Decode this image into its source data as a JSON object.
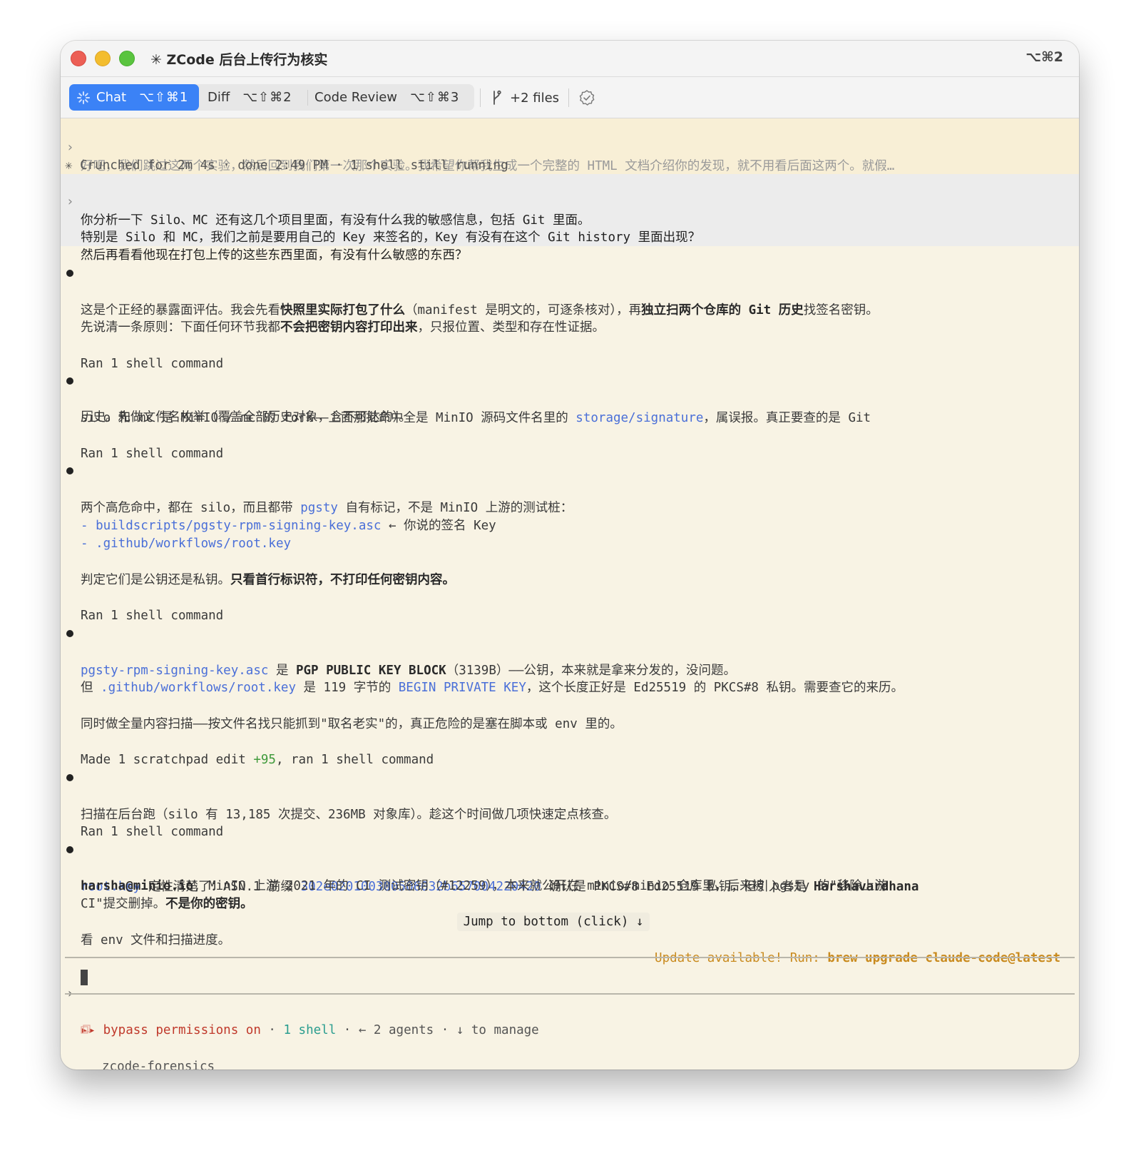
{
  "window": {
    "title": "✳ ZCode 后台上传行为核实",
    "shortcut": "⌥⌘2"
  },
  "tabs": [
    {
      "label": "Chat",
      "shortcut": "⌥⇧⌘1",
      "active": true
    },
    {
      "label": "Diff",
      "shortcut": "⌥⇧⌘2",
      "active": false
    },
    {
      "label": "Code Review",
      "shortcut": "⌥⇧⌘3",
      "active": false
    }
  ],
  "files_label": "+2 files",
  "colors": {
    "accent": "#3b82f6",
    "background": "#f8f3e4",
    "link": "#4a6fd8",
    "warning": "#c98a1d",
    "danger": "#c0392b"
  },
  "transcript": {
    "prev_prompt": "好吧，我们跳过这两个实验，然后回到我们第一次那个实验。我希望你帮我生成一个完整的 HTML 文档介绍你的发现，就不用看后面这两个。就假…",
    "crunched": "✳ Crunched for 2m 4s · done 2:49 PM · 1 shell still running",
    "user_prompt": [
      "你分析一下 Silo、MC 还有这几个项目里面，有没有什么我的敏感信息，包括 Git 里面。",
      "特别是 Silo 和 MC，我们之前是要用自己的 Key 来签名的，Key 有没有在这个 Git history 里面出现？",
      "然后再看看他现在打包上传的这些东西里面，有没有什么敏感的东西？"
    ],
    "m1": {
      "a": "这是个正经的暴露面评估。我会先看",
      "b": "快照里实际打包了什么",
      "c": "（manifest 是明文的，可逐条核对），再",
      "d": "独立扫两个仓库的 Git 历史",
      "e": "找签名密钥。",
      "p2a": "先说清一条原则：下面任何环节我都",
      "p2b": "不会把密钥内容打印出来",
      "p2c": "，只报位置、类型和存在性证据。",
      "ran": "Ran 1 shell command"
    },
    "m2": {
      "a": "silo 和 mc 是 MinIO / mc 的 fork——上面那批命中全是 MinIO 源码文件名里的 ",
      "link": "storage/signature",
      "b": "，属误报。真正要查的是 Git",
      "c": "历史。先做文件名枚举（覆盖全部历史对象，含不可达的）。",
      "ran": "Ran 1 shell command"
    },
    "m3": {
      "a": "两个高危命中，都在 silo，而且都带 ",
      "link": "pgsty",
      "b": " 自有标记，不是 MinIO 上游的测试桩：",
      "item1_dash": "- ",
      "item1_link": "buildscripts/pgsty-rpm-signing-key.asc",
      "item1_note": " ← 你说的签名 Key",
      "item2_dash": "- ",
      "item2_link": ".github/workflows/root.key",
      "p2a": "判定它们是公钥还是私钥。",
      "p2b": "只看首行标识符，不打印任何密钥内容。",
      "ran": "Ran 1 shell command"
    },
    "m4": {
      "link": "pgsty-rpm-signing-key.asc",
      "a": " 是 ",
      "b": "PGP PUBLIC KEY BLOCK",
      "c": "（3139B）——公钥，本来就是拿来分发的，没问题。",
      "p2a": "但 ",
      "p2link": ".github/workflows/root.key",
      "p2b": " 是 119 字节的 ",
      "p2link2": "BEGIN PRIVATE KEY",
      "p2c": "，这个长度正好是 Ed25519 的 PKCS#8 私钥。需要查它的来历。",
      "p3": "同时做全量内容扫描——按文件名找只能抓到\"取名老实\"的，真正危险的是塞在脚本或 env 里的。",
      "made_a": "Made 1 scratchpad edit ",
      "made_plus": "+95",
      "made_b": ", ran 1 shell command"
    },
    "m5": {
      "a": "扫描在后台跑（silo 有 13,185 次提交、236MB 对象库）。趁这个时间做几项快速定点核查。",
      "ran": "Ran 1 shell command"
    },
    "m6": {
      "link": "root.key",
      "a": " 定性清楚了：ASN.1 前缀 ",
      "hex": "302e020100300506032b657004220420",
      "b": " 确认是 PKCS#8 Ed25519 私钥，但引入者是 ",
      "name": "Harshavardhana",
      "email": "harsha@minio.io",
      "c": ", MinIO 上游 2021 年的 CI 测试密钥（#12259），本来就公开在 minio/minio 仓库里，后来被 pgsty 的\"移除上游",
      "d": "CI\"提交删掉。",
      "e": "不是你的密钥。",
      "last": "看 env 文件和扫描进度。"
    }
  },
  "jump_button": "Jump to bottom (click) ↓",
  "update": {
    "prefix": "Update available! Run: ",
    "cmd": "brew upgrade claude-code@latest"
  },
  "input": {
    "prompt": "›"
  },
  "status": {
    "arrows": "▸▸ ",
    "bypass": "bypass permissions on",
    "sep1": " · ",
    "shell": "1 shell",
    "sep2": " · ",
    "agents": "← 2 agents",
    "sep3": " · ",
    "manage": "↓ to manage",
    "project": "zcode-forensics"
  }
}
